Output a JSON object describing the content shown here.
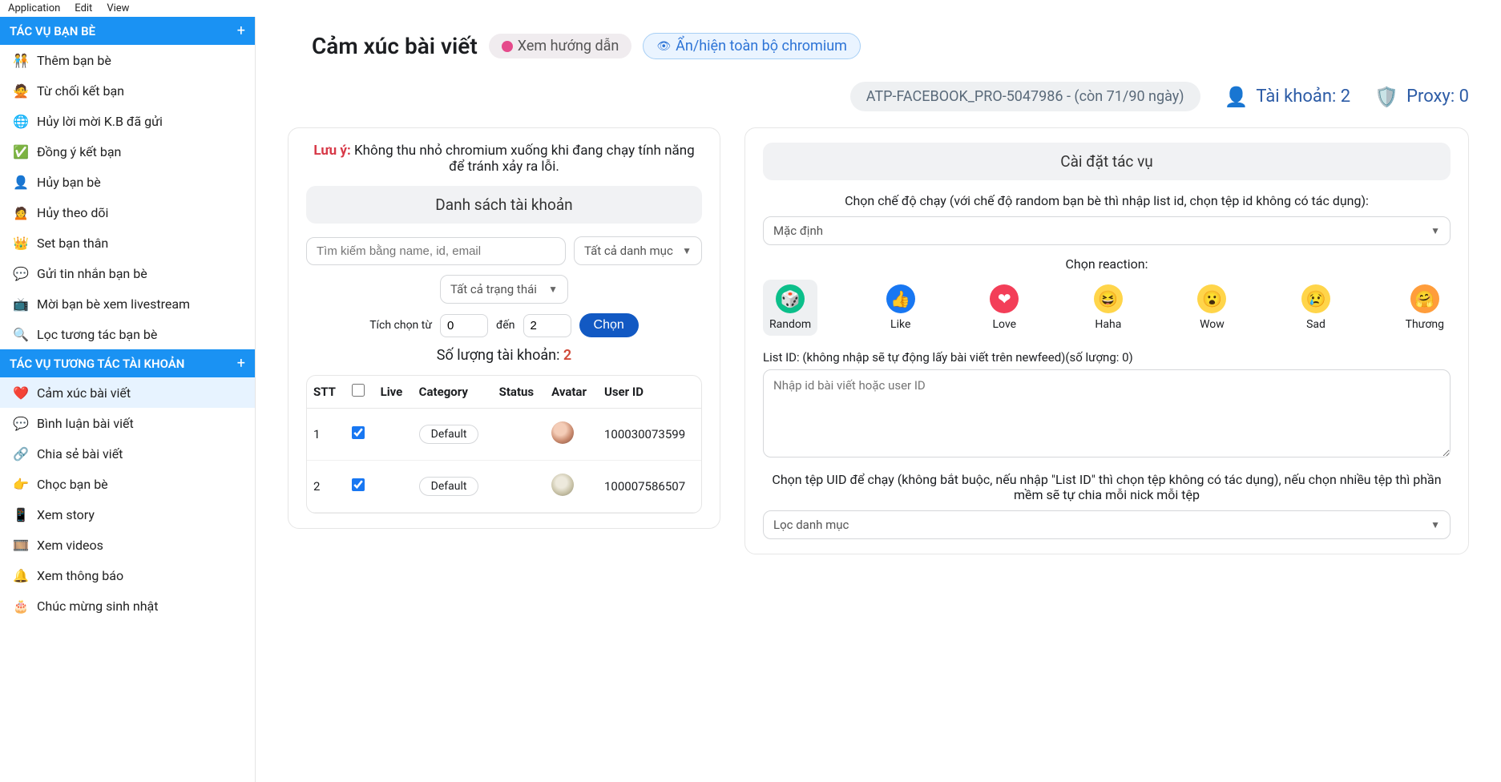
{
  "menubar": [
    "Application",
    "Edit",
    "View"
  ],
  "sidebar": {
    "section1": {
      "title": "TÁC VỤ BẠN BÈ"
    },
    "items1": [
      {
        "icon": "🧑‍🤝‍🧑",
        "label": "Thêm bạn bè"
      },
      {
        "icon": "🙅",
        "label": "Từ chối kết bạn"
      },
      {
        "icon": "🌐",
        "label": "Hủy lời mời K.B đã gửi"
      },
      {
        "icon": "✅",
        "label": "Đồng ý kết bạn"
      },
      {
        "icon": "👤",
        "label": "Hủy bạn bè"
      },
      {
        "icon": "🙍",
        "label": "Hủy theo dõi"
      },
      {
        "icon": "👑",
        "label": "Set bạn thân"
      },
      {
        "icon": "💬",
        "label": "Gửi tin nhắn bạn bè"
      },
      {
        "icon": "📺",
        "label": "Mời bạn bè xem livestream"
      },
      {
        "icon": "🔍",
        "label": "Lọc tương tác bạn bè"
      }
    ],
    "section2": {
      "title": "TÁC VỤ TƯƠNG TÁC TÀI KHOẢN"
    },
    "items2": [
      {
        "icon": "❤️",
        "label": "Cảm xúc bài viết",
        "active": true
      },
      {
        "icon": "💬",
        "label": "Bình luận bài viết"
      },
      {
        "icon": "🔗",
        "label": "Chia sẻ bài viết"
      },
      {
        "icon": "👉",
        "label": "Chọc bạn bè"
      },
      {
        "icon": "📱",
        "label": "Xem story"
      },
      {
        "icon": "🎞️",
        "label": "Xem videos"
      },
      {
        "icon": "🔔",
        "label": "Xem thông báo"
      },
      {
        "icon": "🎂",
        "label": "Chúc mừng sinh nhật"
      }
    ]
  },
  "header": {
    "title": "Cảm xúc bài viết",
    "guide": "Xem hướng dẫn",
    "chromium": "Ẩn/hiện toàn bộ chromium"
  },
  "topbar": {
    "license": "ATP-FACEBOOK_PRO-5047986 - (còn 71/90 ngày)",
    "accounts_label": "Tài khoản: 2",
    "proxy_label": "Proxy: 0"
  },
  "left": {
    "notice_bold": "Lưu ý:",
    "notice_text": "Không thu nhỏ chromium xuống khi đang chạy tính năng để tránh xảy ra lỗi.",
    "banner": "Danh sách tài khoản",
    "search_placeholder": "Tìm kiếm bằng name, id, email",
    "category_select": "Tất cả danh mục",
    "status_select": "Tất cả trạng thái",
    "tick_from": "Tích chọn từ",
    "to": "đến",
    "from_val": "0",
    "to_val": "2",
    "choose": "Chọn",
    "count_label": "Số lượng tài khoản:",
    "count_val": "2",
    "cols": {
      "stt": "STT",
      "live": "Live",
      "category": "Category",
      "status": "Status",
      "avatar": "Avatar",
      "userid": "User ID"
    },
    "rows": [
      {
        "stt": "1",
        "cat": "Default",
        "uid": "100030073599"
      },
      {
        "stt": "2",
        "cat": "Default",
        "uid": "100007586507"
      }
    ]
  },
  "right": {
    "banner": "Cài đặt tác vụ",
    "mode_label": "Chọn chế độ chạy (với chế độ random bạn bè thì nhập list id, chọn tệp id không có tác dụng):",
    "mode_value": "Mặc định",
    "reaction_label": "Chọn reaction:",
    "reactions": [
      {
        "key": "random",
        "label": "Random",
        "emoji": "🎲"
      },
      {
        "key": "like",
        "label": "Like",
        "emoji": "👍"
      },
      {
        "key": "love",
        "label": "Love",
        "emoji": "❤"
      },
      {
        "key": "haha",
        "label": "Haha",
        "emoji": "😆"
      },
      {
        "key": "wow",
        "label": "Wow",
        "emoji": "😮"
      },
      {
        "key": "sad",
        "label": "Sad",
        "emoji": "😢"
      },
      {
        "key": "care",
        "label": "Thương",
        "emoji": "🤗"
      }
    ],
    "listid_label": "List ID: (không nhập sẽ tự động lấy bài viết trên newfeed)(số lượng: 0)",
    "listid_placeholder": "Nhập id bài viết hoặc user ID",
    "uid_label": "Chọn tệp UID để chạy (không bắt buộc, nếu nhập \"List ID\" thì chọn tệp không có tác dụng), nếu chọn nhiều tệp thì phần mềm sẽ tự chia mỗi nick mỗi tệp",
    "uid_select": "Lọc danh mục"
  }
}
